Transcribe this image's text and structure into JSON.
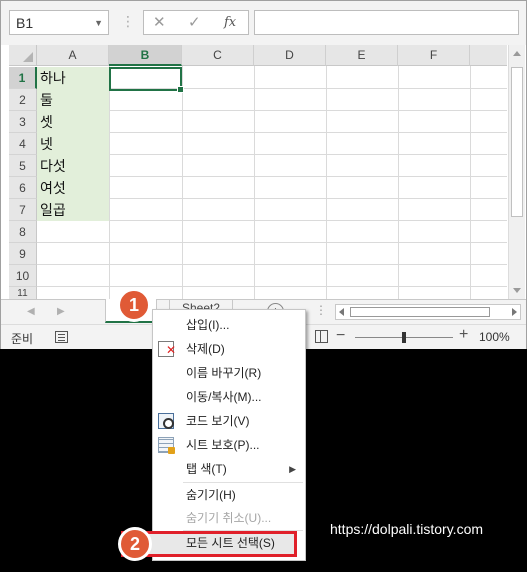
{
  "formula_bar": {
    "name_box": "B1",
    "cancel_glyph": "✕",
    "enter_glyph": "✓",
    "fx_glyph": "fx",
    "formula": ""
  },
  "columns": [
    "A",
    "B",
    "C",
    "D",
    "E",
    "F"
  ],
  "rows": [
    "1",
    "2",
    "3",
    "4",
    "5",
    "6",
    "7",
    "8",
    "9",
    "10",
    "11"
  ],
  "cells_a": [
    "하나",
    "둘",
    "셋",
    "넷",
    "다섯",
    "여섯",
    "일곱"
  ],
  "sheet_tabs": {
    "tab1": "",
    "tab2": "Sheet2",
    "add_glyph": "+"
  },
  "status_bar": {
    "status": "준비",
    "zoom_minus": "−",
    "zoom_plus": "+",
    "zoom_level": "100%",
    "zoom_fraction": 0.5
  },
  "context_menu": {
    "insert": "삽입(I)...",
    "delete": "삭제(D)",
    "rename": "이름 바꾸기(R)",
    "move_copy": "이동/복사(M)...",
    "view_code": "코드 보기(V)",
    "protect_sheet": "시트 보호(P)...",
    "tab_color": "탭 색(T)",
    "hide": "숨기기(H)",
    "unhide": "숨기기 취소(U)...",
    "select_all_sheets": "모든 시트 선택(S)"
  },
  "callouts": [
    "1",
    "2"
  ],
  "watermark": "https://dolpali.tistory.com",
  "colors": {
    "excel_green": "#217346",
    "selection_fill": "#e2efda",
    "callout": "#e05a36",
    "highlight_border": "#e0202a"
  }
}
